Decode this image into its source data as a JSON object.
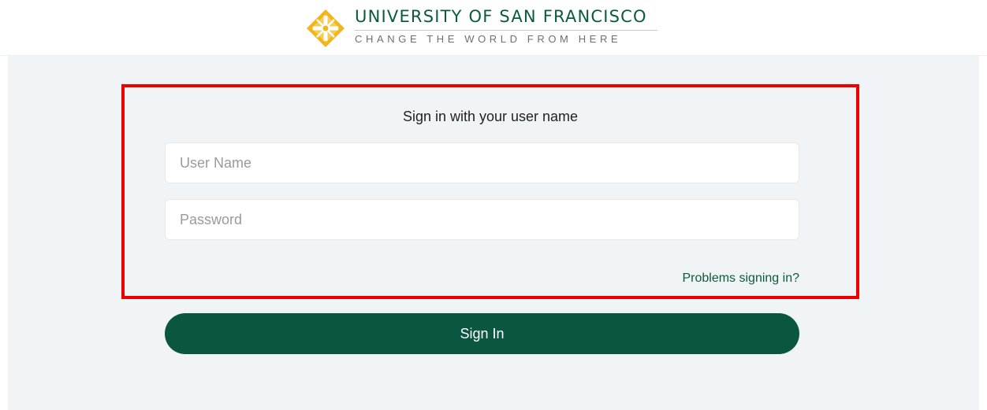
{
  "header": {
    "university_name": "UNIVERSITY OF SAN FRANCISCO",
    "tagline": "CHANGE THE WORLD FROM HERE",
    "logo_icon": "usf-cross-logo-icon",
    "brand_green": "#0b5a3f",
    "logo_gold": "#f2b61c"
  },
  "signin": {
    "heading": "Sign in with your user name",
    "username": {
      "value": "",
      "placeholder": "User Name"
    },
    "password": {
      "value": "",
      "placeholder": "Password"
    },
    "problems_link": "Problems signing in?",
    "submit_label": "Sign In",
    "button_color": "#0a5641"
  },
  "annotation": {
    "highlight_color": "#ee0000"
  }
}
